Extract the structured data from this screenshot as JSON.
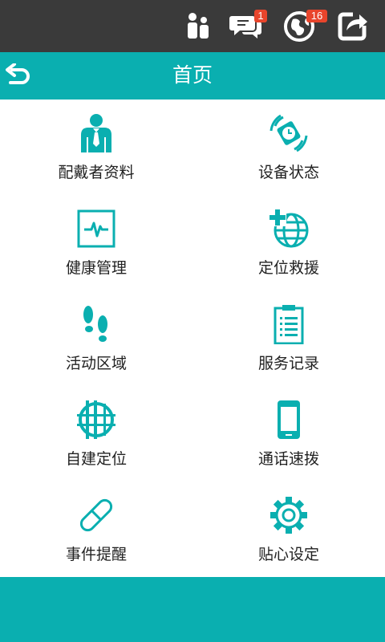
{
  "status_bar": {
    "icons": [
      "family-icon",
      "chat-icon",
      "globe-icon",
      "share-exit-icon"
    ],
    "chat_badge": "1",
    "globe_badge": "16"
  },
  "header": {
    "title": "首页",
    "back_icon": "back-arrow-icon"
  },
  "colors": {
    "accent": "#0aafb0",
    "status_bar": "#3a3a3a",
    "badge": "#e8452c"
  },
  "menu": [
    {
      "label": "配戴者资料",
      "icon": "wearer-profile-icon"
    },
    {
      "label": "设备状态",
      "icon": "device-status-icon"
    },
    {
      "label": "健康管理",
      "icon": "health-monitor-icon"
    },
    {
      "label": "定位救援",
      "icon": "rescue-globe-icon"
    },
    {
      "label": "活动区域",
      "icon": "footprints-icon"
    },
    {
      "label": "服务记录",
      "icon": "clipboard-icon"
    },
    {
      "label": "自建定位",
      "icon": "custom-location-icon"
    },
    {
      "label": "通话速拨",
      "icon": "phone-icon"
    },
    {
      "label": "事件提醒",
      "icon": "pill-icon"
    },
    {
      "label": "贴心设定",
      "icon": "gear-icon"
    }
  ]
}
